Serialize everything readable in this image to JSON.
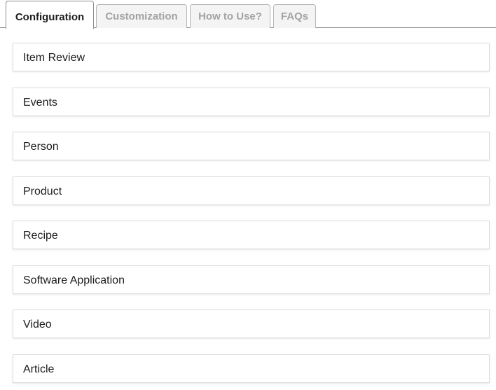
{
  "tabs": [
    {
      "label": "Configuration",
      "active": true
    },
    {
      "label": "Customization",
      "active": false
    },
    {
      "label": "How to Use?",
      "active": false
    },
    {
      "label": "FAQs",
      "active": false
    }
  ],
  "panels": [
    {
      "label": "Item Review"
    },
    {
      "label": "Events"
    },
    {
      "label": "Person"
    },
    {
      "label": "Product"
    },
    {
      "label": "Recipe"
    },
    {
      "label": "Software Application"
    },
    {
      "label": "Video"
    },
    {
      "label": "Article"
    }
  ]
}
